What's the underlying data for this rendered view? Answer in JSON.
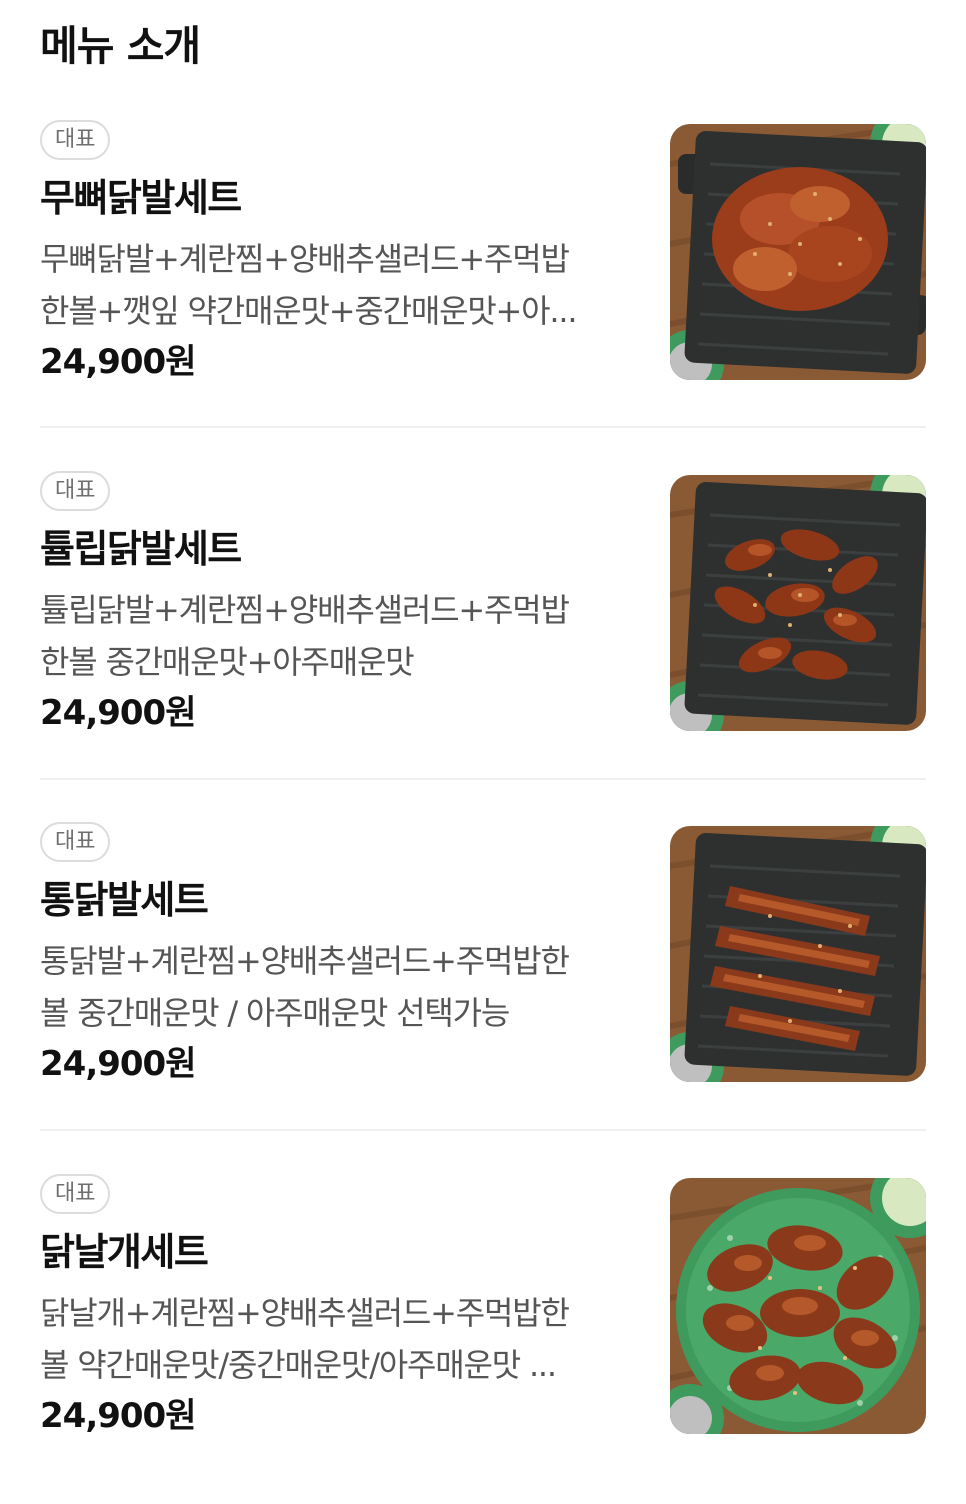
{
  "section": {
    "title": "메뉴 소개"
  },
  "items": [
    {
      "badge": "대표",
      "name": "무뼈닭발세트",
      "desc_line1": "무뼈닭발+계란찜+양배추샐러드+주먹밥",
      "desc_line2": "한볼+깻잎 약간매운맛+중간매운맛+아...",
      "price": "24,900원",
      "image": "boneless-chicken-feet-on-grill-plate"
    },
    {
      "badge": "대표",
      "name": "튤립닭발세트",
      "desc_line1": "튤립닭발+계란찜+양배추샐러드+주먹밥",
      "desc_line2": "한볼 중간매운맛+아주매운맛",
      "price": "24,900원",
      "image": "tulip-chicken-feet-on-grill-plate"
    },
    {
      "badge": "대표",
      "name": "통닭발세트",
      "desc_line1": "통닭발+계란찜+양배추샐러드+주먹밥한",
      "desc_line2": "볼 중간매운맛 / 아주매운맛 선택가능",
      "price": "24,900원",
      "image": "whole-chicken-feet-on-grill-plate"
    },
    {
      "badge": "대표",
      "name": "닭날개세트",
      "desc_line1": "닭날개+계란찜+양배추샐러드+주먹밥한",
      "desc_line2": "볼 약간매운맛/중간매운맛/아주매운맛 ...",
      "price": "24,900원",
      "image": "chicken-wings-on-green-plate"
    }
  ],
  "colors": {
    "background": "#ffffff",
    "title": "#111111",
    "description": "#555555",
    "badge_border": "#dcdcdc",
    "badge_text": "#6f6f6f",
    "divider": "#efefef",
    "wood": "#8a5a35",
    "grill": "#2e3030",
    "sauce": "#a5411c",
    "green_plate": "#3f9a5e"
  }
}
